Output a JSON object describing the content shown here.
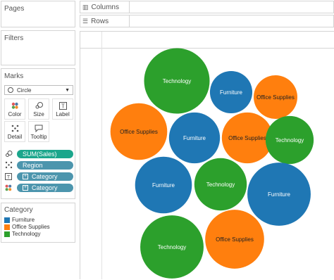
{
  "sidebar": {
    "pages_title": "Pages",
    "filters_title": "Filters",
    "marks_title": "Marks",
    "mark_type": "Circle",
    "buttons": {
      "color": "Color",
      "size": "Size",
      "label": "Label",
      "detail": "Detail",
      "tooltip": "Tooltip"
    },
    "pills": [
      "SUM(Sales)",
      "Region",
      "Category",
      "Category"
    ],
    "legend_title": "Category",
    "legend_items": [
      {
        "label": "Furniture",
        "color": "#1f77b4"
      },
      {
        "label": "Office Supplies",
        "color": "#ff7f0e"
      },
      {
        "label": "Technology",
        "color": "#2ca02c"
      }
    ]
  },
  "shelves": {
    "columns": "Columns",
    "rows": "Rows"
  },
  "colors": {
    "Furniture": "#1f77b4",
    "Office Supplies": "#ff7f0e",
    "Technology": "#2ca02c"
  },
  "bubbles": [
    {
      "category": "Technology",
      "sales": 225
    },
    {
      "category": "Furniture",
      "sales": 94
    },
    {
      "category": "Office Supplies",
      "sales": 100
    },
    {
      "category": "Office Supplies",
      "sales": 169
    },
    {
      "category": "Furniture",
      "sales": 136
    },
    {
      "category": "Office Supplies",
      "sales": 136
    },
    {
      "category": "Technology",
      "sales": 121
    },
    {
      "category": "Furniture",
      "sales": 169
    },
    {
      "category": "Technology",
      "sales": 144
    },
    {
      "category": "Furniture",
      "sales": 210
    },
    {
      "category": "Technology",
      "sales": 210
    },
    {
      "category": "Office Supplies",
      "sales": 182
    }
  ]
}
